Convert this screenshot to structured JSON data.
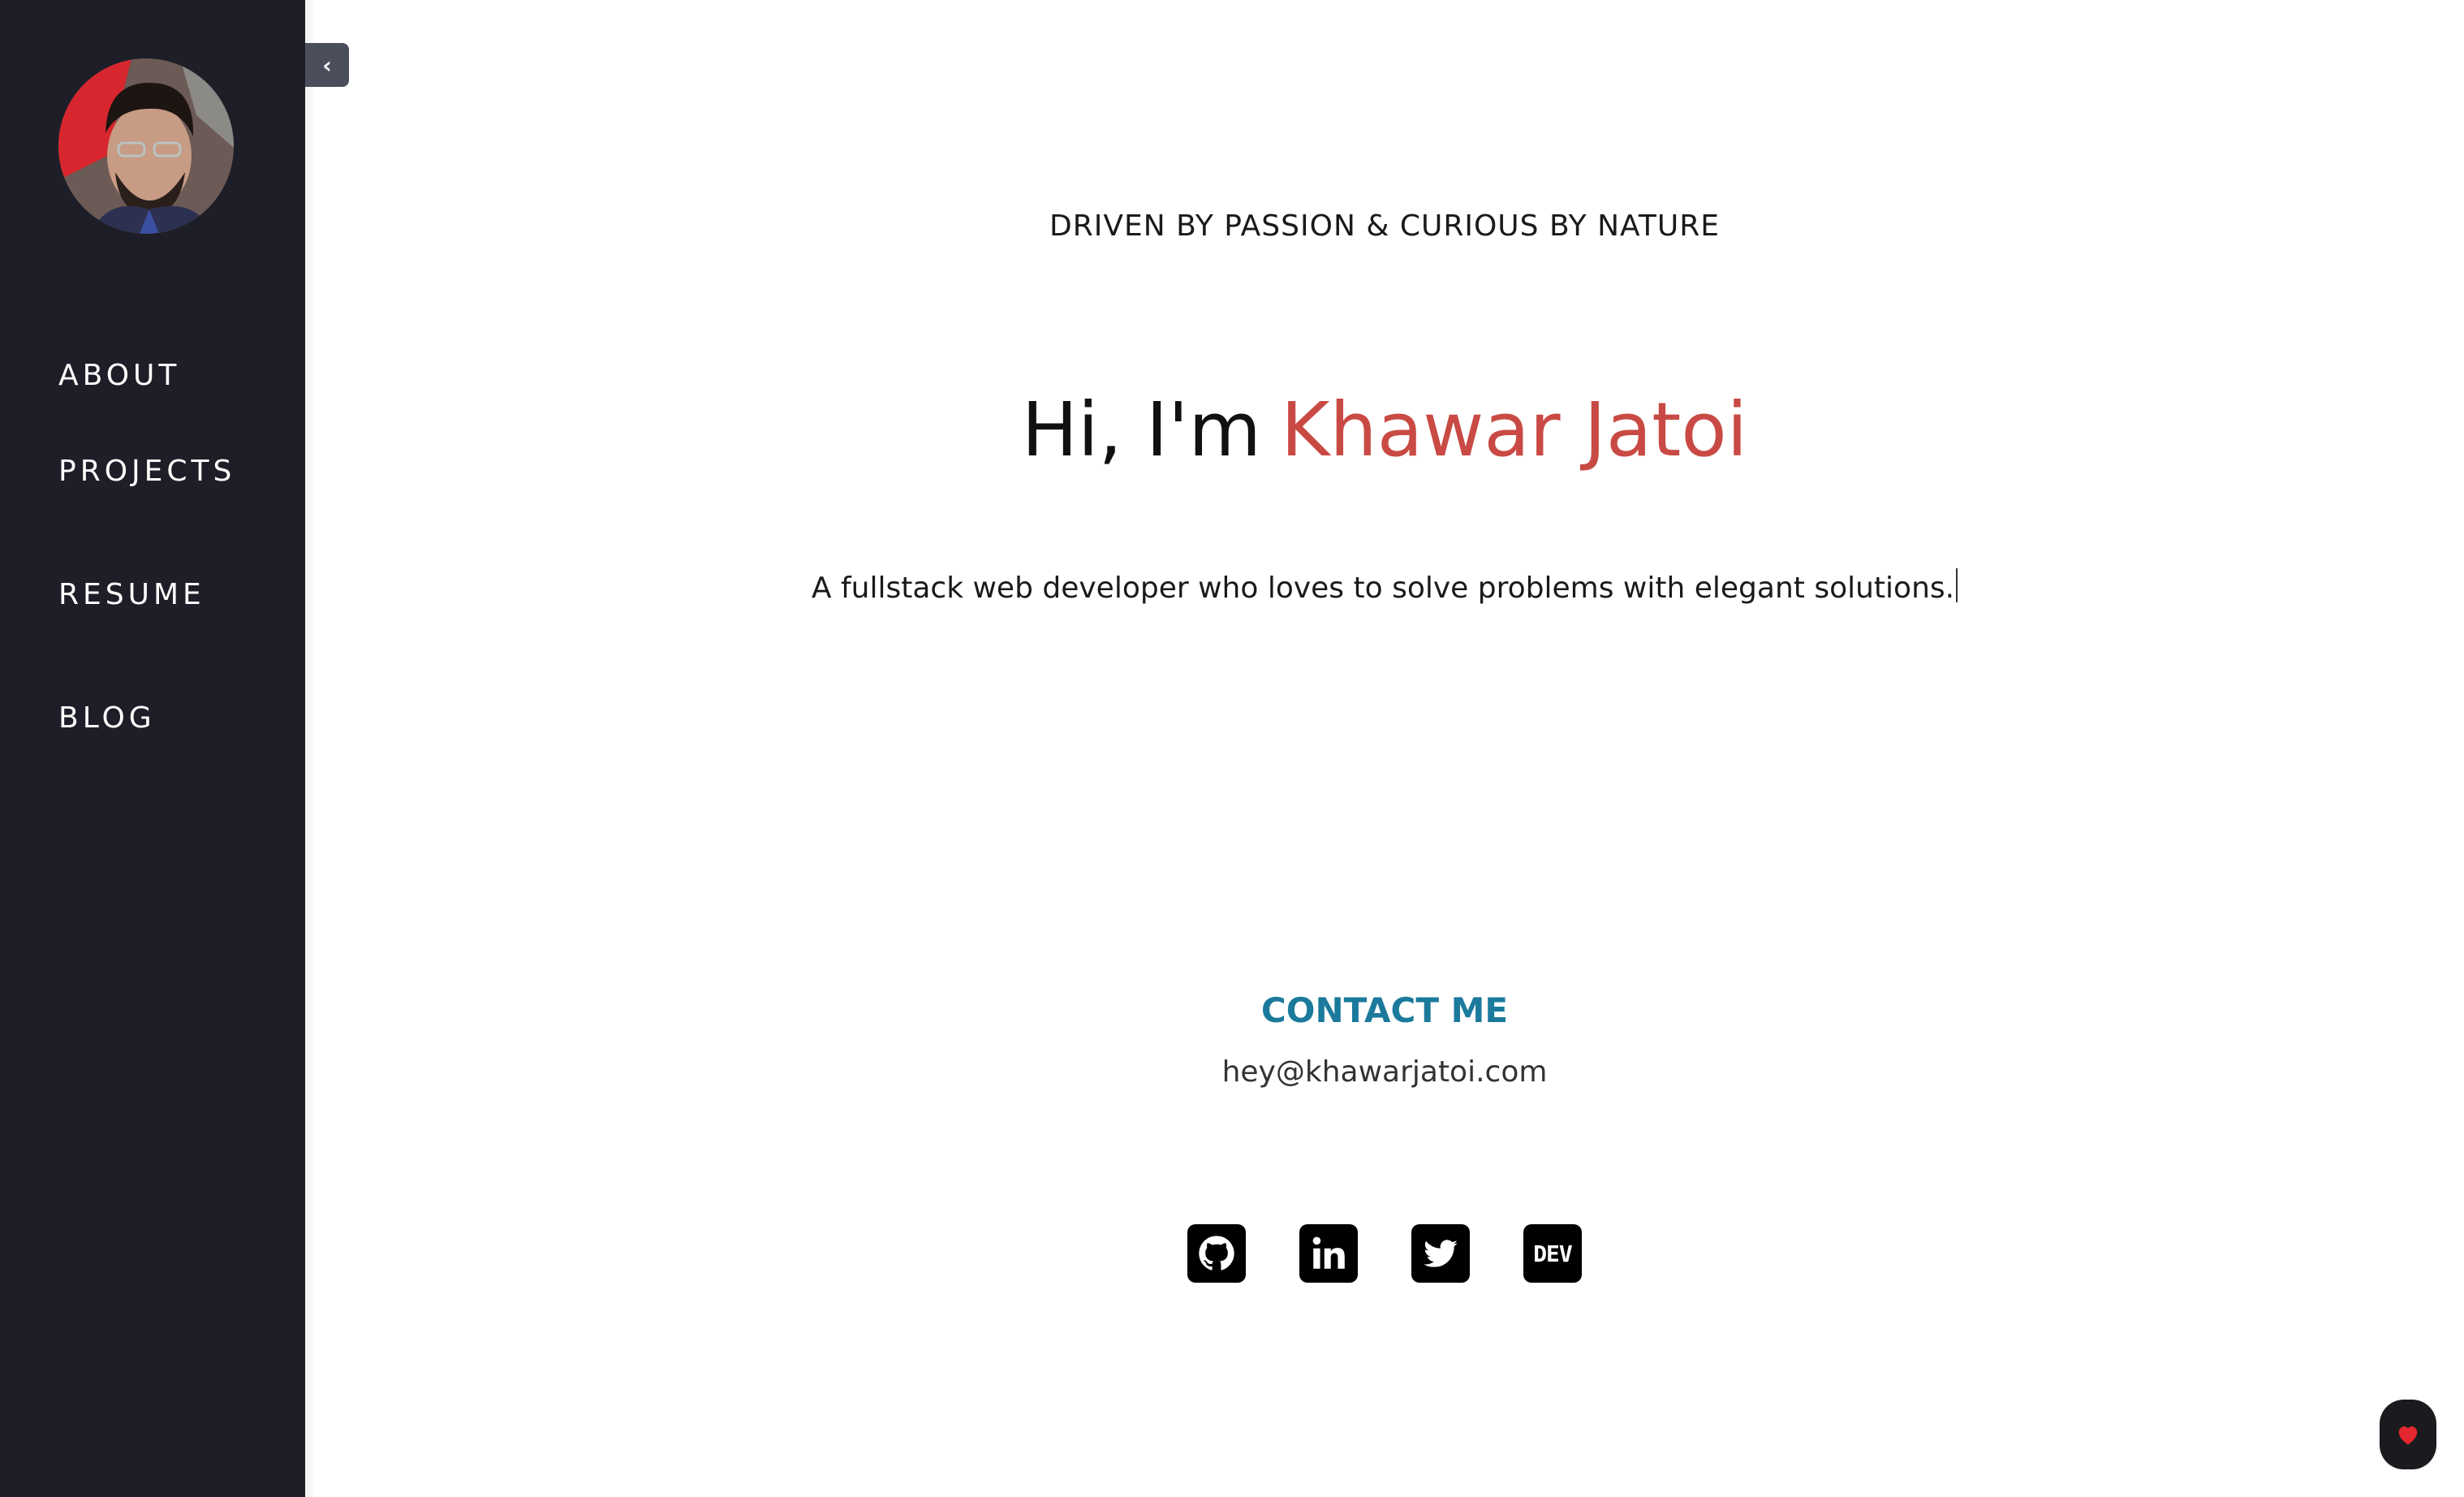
{
  "sidebar": {
    "nav": [
      {
        "label": "ABOUT"
      },
      {
        "label": "PROJECTS"
      },
      {
        "label": "RESUME"
      },
      {
        "label": "BLOG"
      }
    ],
    "toggle_glyph": "‹"
  },
  "hero": {
    "tagline": "DRIVEN BY PASSION & CURIOUS BY NATURE",
    "greeting": "Hi, I'm",
    "name": "Khawar Jatoi",
    "subtitle": "A fullstack web developer who loves to solve problems with elegant solutions."
  },
  "contact": {
    "title": "CONTACT ME",
    "email": "hey@khawarjatoi.com"
  },
  "socials": [
    {
      "icon": "github-icon"
    },
    {
      "icon": "linkedin-icon"
    },
    {
      "icon": "twitter-icon"
    },
    {
      "icon": "dev-icon",
      "label": "DEV"
    }
  ],
  "colors": {
    "sidebar_bg": "#1e1e28",
    "name_accent": "#c94a44",
    "contact_accent": "#1b7a9c"
  }
}
